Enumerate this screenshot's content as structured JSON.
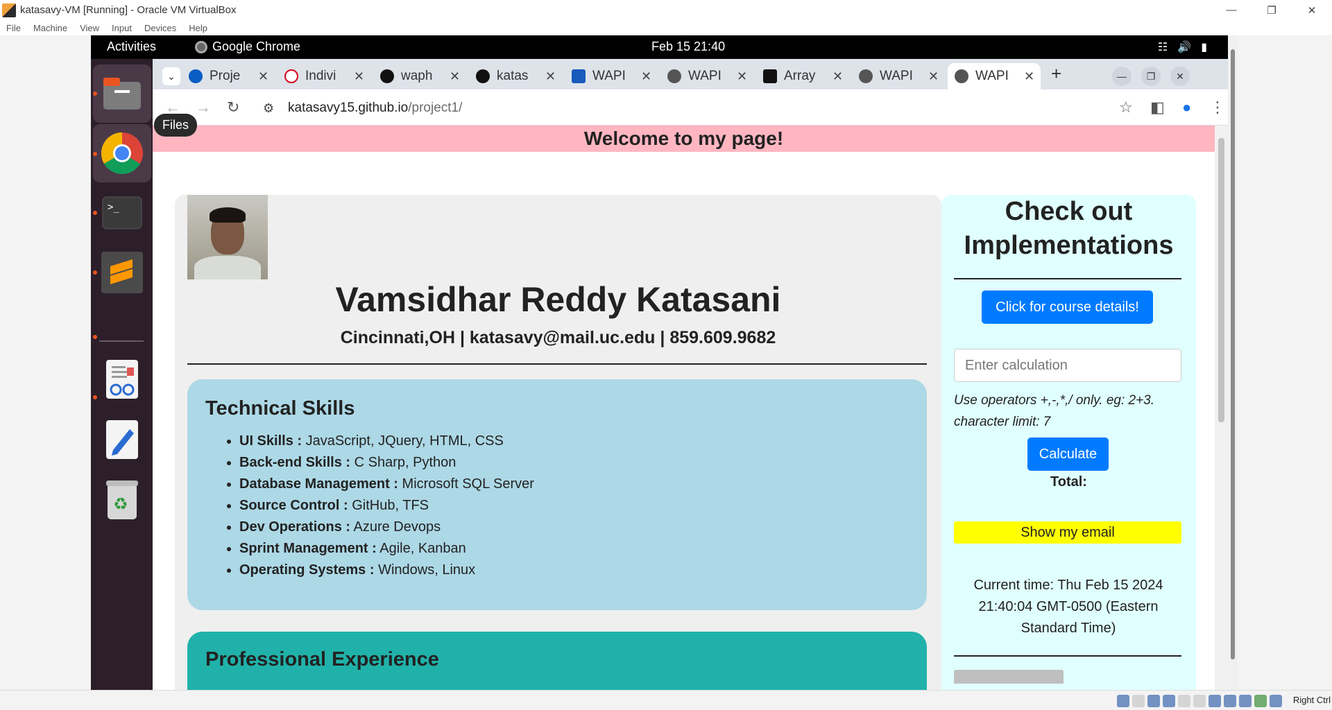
{
  "virtualbox": {
    "title": "katasavy-VM [Running] - Oracle VM VirtualBox",
    "menu": [
      "File",
      "Machine",
      "View",
      "Input",
      "Devices",
      "Help"
    ],
    "host_key": "Right Ctrl"
  },
  "gnome": {
    "activities": "Activities",
    "app_name": "Google Chrome",
    "clock": "Feb 15  21:40",
    "dock_tooltip": "Files"
  },
  "chrome": {
    "tabs": [
      {
        "label": "Proje",
        "icon": "onedrive-icon",
        "color": "#0a5dc2"
      },
      {
        "label": "Indivi",
        "icon": "uc-icon",
        "color": "#d6001c"
      },
      {
        "label": "waph",
        "icon": "github-icon",
        "color": "#111111"
      },
      {
        "label": "katas",
        "icon": "github-icon",
        "color": "#111111"
      },
      {
        "label": "WAPI",
        "icon": "word-icon",
        "color": "#185abd"
      },
      {
        "label": "WAPI",
        "icon": "globe-icon",
        "color": "#444444"
      },
      {
        "label": "Array",
        "icon": "mdn-icon",
        "color": "#111111"
      },
      {
        "label": "WAPI",
        "icon": "globe-icon",
        "color": "#444444"
      },
      {
        "label": "WAPI",
        "icon": "globe-icon",
        "color": "#444444"
      }
    ],
    "new_tab": "+",
    "url_host": "katasavy15.github.io",
    "url_path": "/project1/"
  },
  "page": {
    "welcome": "Welcome to my page!",
    "name": "Vamsidhar Reddy Katasani",
    "contact": "Cincinnati,OH | katasavy@mail.uc.edu | 859.609.9682",
    "skills_title": "Technical Skills",
    "skills": [
      {
        "label": "UI Skills :",
        "value": "JavaScript, JQuery, HTML, CSS"
      },
      {
        "label": "Back-end Skills :",
        "value": "C Sharp, Python"
      },
      {
        "label": "Database Management :",
        "value": "Microsoft SQL Server"
      },
      {
        "label": "Source Control :",
        "value": "GitHub, TFS"
      },
      {
        "label": "Dev Operations :",
        "value": "Azure Devops"
      },
      {
        "label": "Sprint Management :",
        "value": "Agile, Kanban"
      },
      {
        "label": "Operating Systems :",
        "value": "Windows, Linux"
      }
    ],
    "experience_title": "Professional Experience",
    "sidebar": {
      "title_line1": "Check out",
      "title_line2": "Implementations",
      "course_button": "Click for course details!",
      "calc_placeholder": "Enter calculation",
      "calc_hint_line1": "Use operators +,-,*,/ only. eg: 2+3.",
      "calc_hint_line2": "character limit: 7",
      "calculate_button": "Calculate",
      "total_label": "Total:",
      "email_button": "Show my email",
      "time_line1": "Current time: Thu Feb 15 2024",
      "time_line2": "21:40:04 GMT-0500 (Eastern",
      "time_line3": "Standard Time)"
    }
  },
  "colors": {
    "welcome_bg": "#ffb6c1",
    "skills_bg": "#add8e6",
    "experience_bg": "#20b2aa",
    "sidebar_bg": "#e0ffff",
    "button_blue": "#007bff",
    "email_button": "#ffff00"
  }
}
